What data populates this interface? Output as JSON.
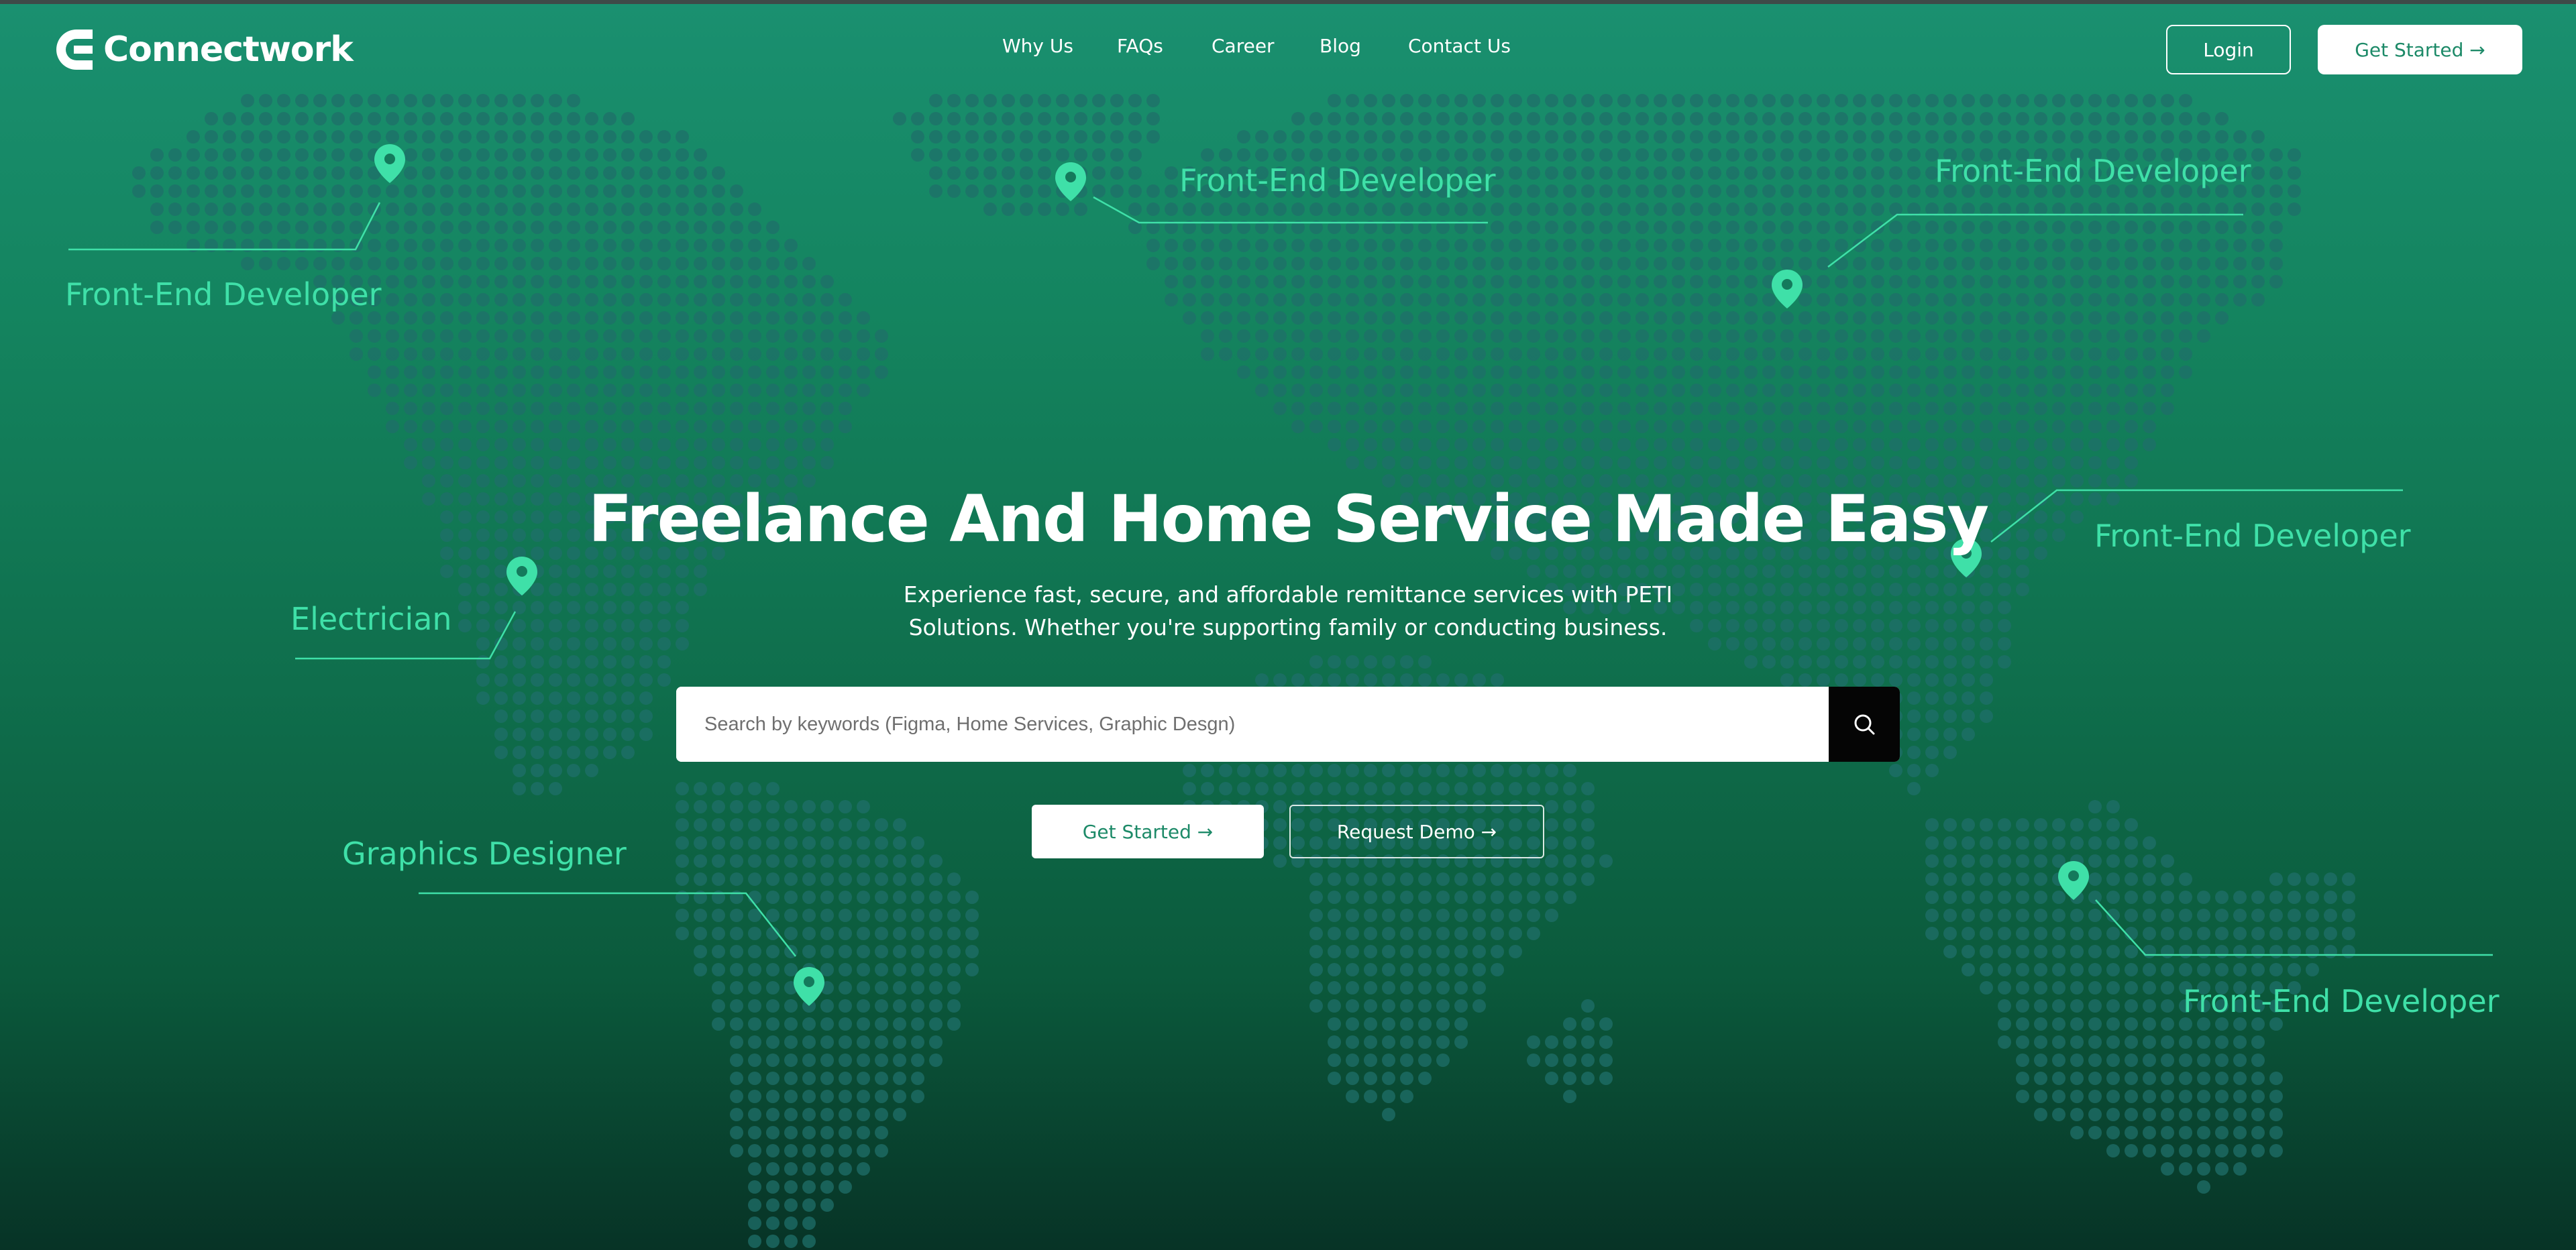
{
  "brand": {
    "name": "Connectwork"
  },
  "nav": {
    "items": [
      {
        "label": "Why Us"
      },
      {
        "label": "FAQs"
      },
      {
        "label": "Career"
      },
      {
        "label": "Blog"
      },
      {
        "label": "Contact Us"
      }
    ],
    "login_label": "Login",
    "get_started_label": "Get Started →"
  },
  "hero": {
    "title": "Freelance And Home Service Made Easy",
    "subtitle_line1": "Experience fast, secure, and affordable remittance services with PETI",
    "subtitle_line2": "Solutions. Whether you're supporting family or conducting business.",
    "search_placeholder": "Search by keywords (Figma, Home Services, Graphic Desgn)",
    "get_started_label": "Get Started →",
    "request_demo_label": "Request Demo →"
  },
  "map_labels": [
    {
      "text": "Front-End Developer"
    },
    {
      "text": "Front-End Developer"
    },
    {
      "text": "Front-End Developer"
    },
    {
      "text": "Electrician"
    },
    {
      "text": "Front-End Developer"
    },
    {
      "text": "Graphics Designer"
    },
    {
      "text": "Front-End Developer"
    }
  ],
  "icons": {
    "logo": "connectwork-logo-icon",
    "search": "search-icon",
    "pin": "map-pin-icon"
  },
  "colors": {
    "accent": "#3fe0a8",
    "background_top": "#1a9070",
    "background_bottom": "#073326",
    "dots": "#1f6f6a"
  }
}
